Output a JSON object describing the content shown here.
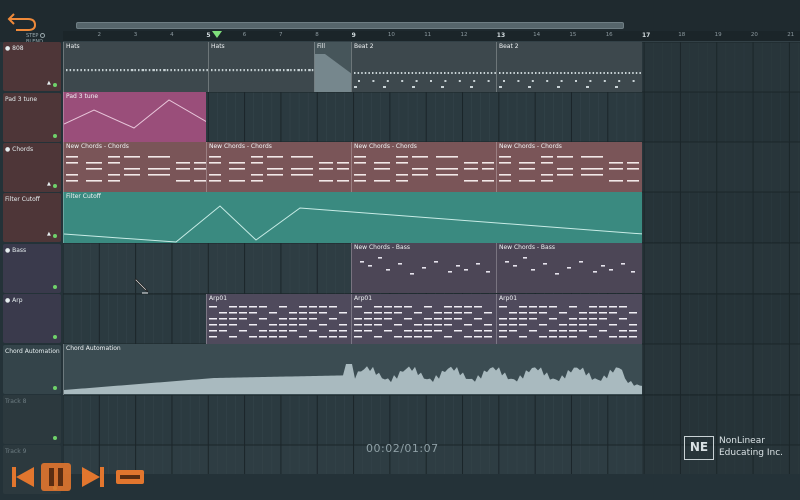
{
  "snap_label": "STEP",
  "snap_label2": "BLEND",
  "ruler": [
    "2",
    "3",
    "4",
    "5",
    "6",
    "7",
    "8",
    "9",
    "10",
    "11",
    "12",
    "13",
    "14",
    "15",
    "16",
    "17",
    "18",
    "19",
    "20",
    "21"
  ],
  "tracks": [
    {
      "name": "808",
      "icon": "pattern-icon",
      "color": "#4e3638"
    },
    {
      "name": "Pad 3 tune",
      "icon": "automation-icon",
      "color": "#4e3638"
    },
    {
      "name": "Chords",
      "icon": "pattern-icon",
      "color": "#4e3638"
    },
    {
      "name": "Filter Cutoff",
      "icon": "automation-icon",
      "color": "#4e3638"
    },
    {
      "name": "Bass",
      "icon": "pattern-icon",
      "color": "#3a3a4c"
    },
    {
      "name": "Arp",
      "icon": "pattern-icon",
      "color": "#3a3a4c"
    },
    {
      "name": "Chord Automation",
      "icon": "audio-icon",
      "color": "#34444a"
    },
    {
      "name": "Track 8",
      "icon": "",
      "color": "#2c393e"
    },
    {
      "name": "Track 9",
      "icon": "",
      "color": "#2c393e"
    }
  ],
  "clips": {
    "hats1": "Hats",
    "hats2": "Hats",
    "fill": "Fill",
    "beat1": "Beat 2",
    "beat2": "Beat 2",
    "pad": "Pad 3 tune",
    "chords1": "New Chords - Chords",
    "chords2": "New Chords - Chords",
    "chords3": "New Chords - Chords",
    "chords4": "New Chords - Chords",
    "filter": "Filter Cutoff",
    "bass1": "New Chords - Bass",
    "bass2": "New Chords - Bass",
    "arp1": "Arp01",
    "arp2": "Arp01",
    "arp3": "Arp01",
    "chordauto": "Chord Automation"
  },
  "time": "00:02/01:07",
  "brand": {
    "logo": "NE",
    "line1": "NonLinear",
    "line2": "Educating Inc."
  },
  "colors": {
    "accent": "#7fe07c",
    "pad_clip": "#9a4e7a",
    "filter_clip": "#3a8a80",
    "chords_clip": "#7a5558",
    "bass_clip": "#4c4656",
    "arp_clip": "#4f4a5c"
  }
}
